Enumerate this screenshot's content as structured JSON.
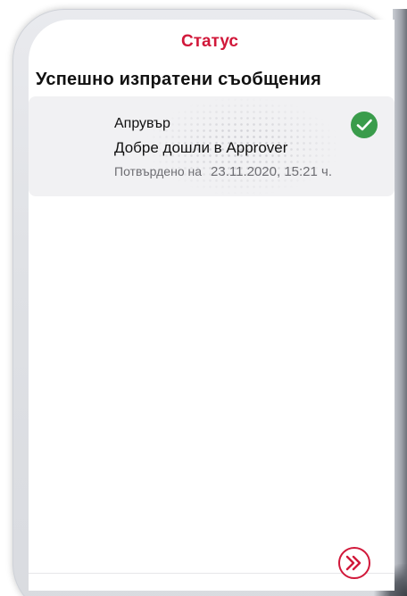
{
  "header": {
    "title": "Статус"
  },
  "section": {
    "heading": "Успешно изпратени съобщения"
  },
  "messages": [
    {
      "sender": "Апрувър",
      "text": "Добре дошли в Approver",
      "confirmed_label": "Потвърдено на",
      "confirmed_datetime": "23.11.2020, 15:21 ч.",
      "status_icon": "check-circle-icon",
      "status_color": "#3a9c4b"
    }
  ],
  "footer": {
    "forward_icon": "double-chevron-right-icon",
    "accent_color": "#d1183a"
  }
}
